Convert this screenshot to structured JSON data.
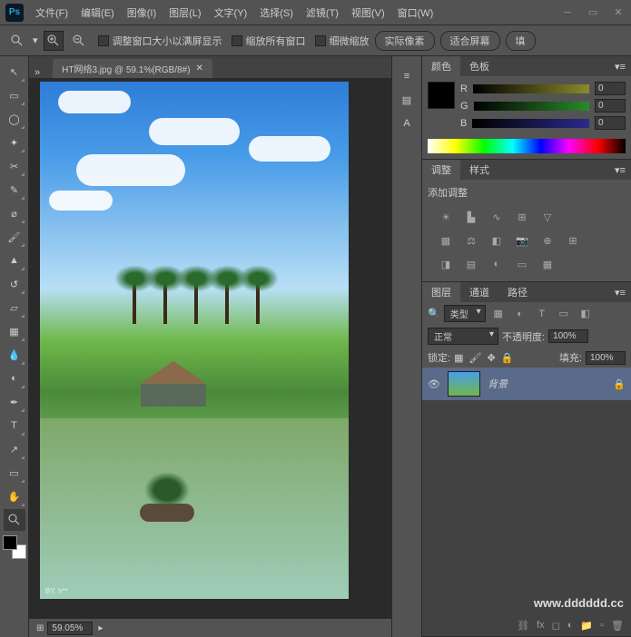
{
  "app": {
    "logo": "Ps"
  },
  "menu": {
    "file": "文件(F)",
    "edit": "编辑(E)",
    "image": "图像(I)",
    "layer": "图层(L)",
    "type": "文字(Y)",
    "select": "选择(S)",
    "filter": "滤镜(T)",
    "view": "视图(V)",
    "window": "窗口(W)"
  },
  "options": {
    "fit_window": "调整窗口大小以满屏显示",
    "zoom_all": "缩放所有窗口",
    "scrubby": "细微缩放",
    "actual": "实际像素",
    "fit_screen": "适合屏幕",
    "fill": "填"
  },
  "document": {
    "tab_title": "HT网络3.jpg @ 59.1%(RGB/8#)",
    "zoom": "59.05%",
    "watermark_left": "BY. h**"
  },
  "color_panel": {
    "tab_color": "颜色",
    "tab_swatches": "色板",
    "r_label": "R",
    "r_val": "0",
    "g_label": "G",
    "g_val": "0",
    "b_label": "B",
    "b_val": "0"
  },
  "adjust_panel": {
    "tab_adjust": "调整",
    "tab_styles": "样式",
    "heading": "添加调整"
  },
  "layers_panel": {
    "tab_layers": "图层",
    "tab_channels": "通道",
    "tab_paths": "路径",
    "filter_kind": "类型",
    "blend_mode": "正常",
    "opacity_label": "不透明度:",
    "opacity_val": "100%",
    "lock_label": "锁定:",
    "fill_label": "填充:",
    "fill_val": "100%",
    "layer_name": "背景"
  },
  "footer": {
    "url": "www.dddddd.cc"
  }
}
